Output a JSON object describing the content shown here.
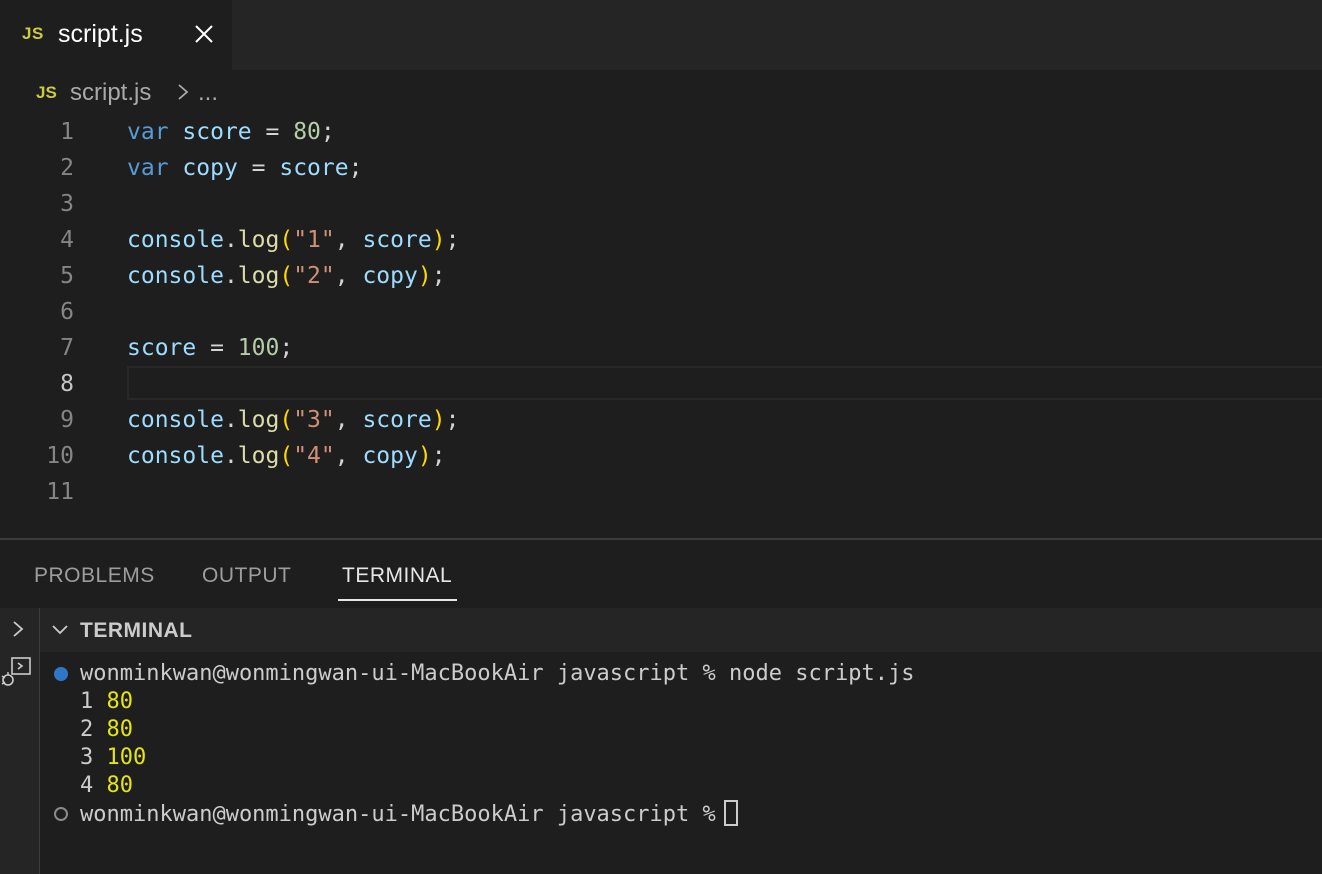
{
  "tab": {
    "icon": "JS",
    "label": "script.js",
    "close_icon": "close-icon"
  },
  "breadcrumb": {
    "icon": "JS",
    "file": "script.js",
    "more": "..."
  },
  "editor": {
    "line_numbers": [
      "1",
      "2",
      "3",
      "4",
      "5",
      "6",
      "7",
      "8",
      "9",
      "10",
      "11"
    ],
    "active_line": "8",
    "lines": [
      [
        [
          "kw",
          "var"
        ],
        [
          "punc",
          " "
        ],
        [
          "var",
          "score"
        ],
        [
          "punc",
          " = "
        ],
        [
          "num-lit",
          "80"
        ],
        [
          "punc",
          ";"
        ]
      ],
      [
        [
          "kw",
          "var"
        ],
        [
          "punc",
          " "
        ],
        [
          "var",
          "copy"
        ],
        [
          "punc",
          " = "
        ],
        [
          "var",
          "score"
        ],
        [
          "punc",
          ";"
        ]
      ],
      [],
      [
        [
          "var",
          "console"
        ],
        [
          "punc",
          "."
        ],
        [
          "fn",
          "log"
        ],
        [
          "paren",
          "("
        ],
        [
          "str",
          "\"1\""
        ],
        [
          "punc",
          ", "
        ],
        [
          "var",
          "score"
        ],
        [
          "paren",
          ")"
        ],
        [
          "punc",
          ";"
        ]
      ],
      [
        [
          "var",
          "console"
        ],
        [
          "punc",
          "."
        ],
        [
          "fn",
          "log"
        ],
        [
          "paren",
          "("
        ],
        [
          "str",
          "\"2\""
        ],
        [
          "punc",
          ", "
        ],
        [
          "var",
          "copy"
        ],
        [
          "paren",
          ")"
        ],
        [
          "punc",
          ";"
        ]
      ],
      [],
      [
        [
          "var",
          "score"
        ],
        [
          "punc",
          " = "
        ],
        [
          "num-lit",
          "100"
        ],
        [
          "punc",
          ";"
        ]
      ],
      [],
      [
        [
          "var",
          "console"
        ],
        [
          "punc",
          "."
        ],
        [
          "fn",
          "log"
        ],
        [
          "paren",
          "("
        ],
        [
          "str",
          "\"3\""
        ],
        [
          "punc",
          ", "
        ],
        [
          "var",
          "score"
        ],
        [
          "paren",
          ")"
        ],
        [
          "punc",
          ";"
        ]
      ],
      [
        [
          "var",
          "console"
        ],
        [
          "punc",
          "."
        ],
        [
          "fn",
          "log"
        ],
        [
          "paren",
          "("
        ],
        [
          "str",
          "\"4\""
        ],
        [
          "punc",
          ", "
        ],
        [
          "var",
          "copy"
        ],
        [
          "paren",
          ")"
        ],
        [
          "punc",
          ";"
        ]
      ],
      []
    ]
  },
  "panel": {
    "tabs": [
      "PROBLEMS",
      "OUTPUT",
      "TERMINAL"
    ],
    "active_tab": "TERMINAL",
    "terminal_title": "TERMINAL"
  },
  "terminal": {
    "prompt1": "wonminkwan@wonmingwan-ui-MacBookAir javascript % node script.js",
    "output": [
      {
        "label": "1",
        "value": "80"
      },
      {
        "label": "2",
        "value": "80"
      },
      {
        "label": "3",
        "value": "100"
      },
      {
        "label": "4",
        "value": "80"
      }
    ],
    "prompt2": "wonminkwan@wonmingwan-ui-MacBookAir javascript %"
  }
}
